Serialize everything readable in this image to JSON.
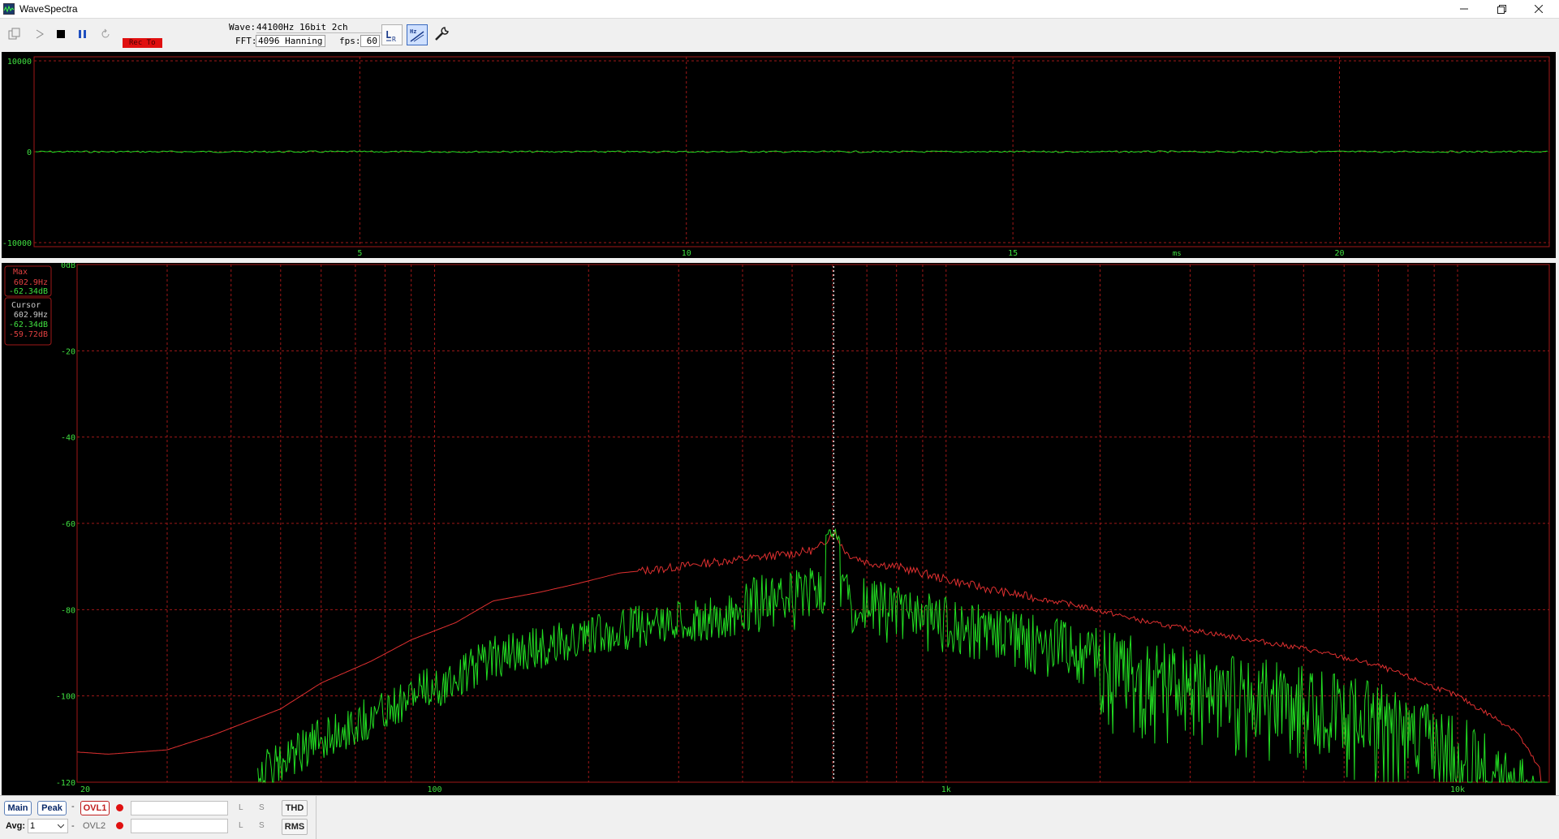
{
  "window": {
    "title": "WaveSpectra",
    "minimize_icon": "minimize-icon",
    "maximize_icon": "restore-icon",
    "close_icon": "close-icon"
  },
  "toolbar": {
    "rec_to_label": "Rec To",
    "wave_label": "Wave:",
    "wave_value": "44100Hz 16bit 2ch",
    "fft_label": "FFT:",
    "fft_value": "4096 Hanning",
    "fps_label": "fps:",
    "fps_value": "60",
    "icons": [
      "copy-icon",
      "play-icon",
      "stop-icon",
      "pause-icon",
      "loop-icon",
      "lr-channel-icon",
      "hz-scale-icon",
      "settings-wrench-icon"
    ]
  },
  "colors": {
    "green_trace": "#22dd22",
    "red_trace": "#e03030",
    "grid_red": "#a01818",
    "label_green": "#40e040",
    "rec_red": "#e01010"
  },
  "waveform": {
    "y_ticks": [
      "10000",
      "0",
      "-10000"
    ],
    "x_ticks": [
      "5",
      "10",
      "15",
      "20"
    ],
    "x_unit": "ms"
  },
  "spectrum": {
    "y_ticks": [
      "0dB",
      "-20",
      "-40",
      "-60",
      "-80",
      "-100",
      "-120"
    ],
    "x_ticks": [
      "20",
      "100",
      "1k",
      "10k"
    ],
    "max_box": {
      "label": "Max",
      "freq": "602.9Hz",
      "level": "-62.34dB"
    },
    "cursor_box": {
      "label": "Cursor",
      "freq": "602.9Hz",
      "level": "-62.34dB",
      "level2": "-59.72dB"
    }
  },
  "bottom": {
    "main_btn": "Main",
    "peak_btn": "Peak",
    "ovl1_btn": "OVL1",
    "ovl2_label": "OVL2",
    "dash": "-",
    "avg_label": "Avg:",
    "avg_value": "1",
    "l_label": "L",
    "s_label": "S",
    "thd_btn": "THD",
    "rms_btn": "RMS"
  }
}
